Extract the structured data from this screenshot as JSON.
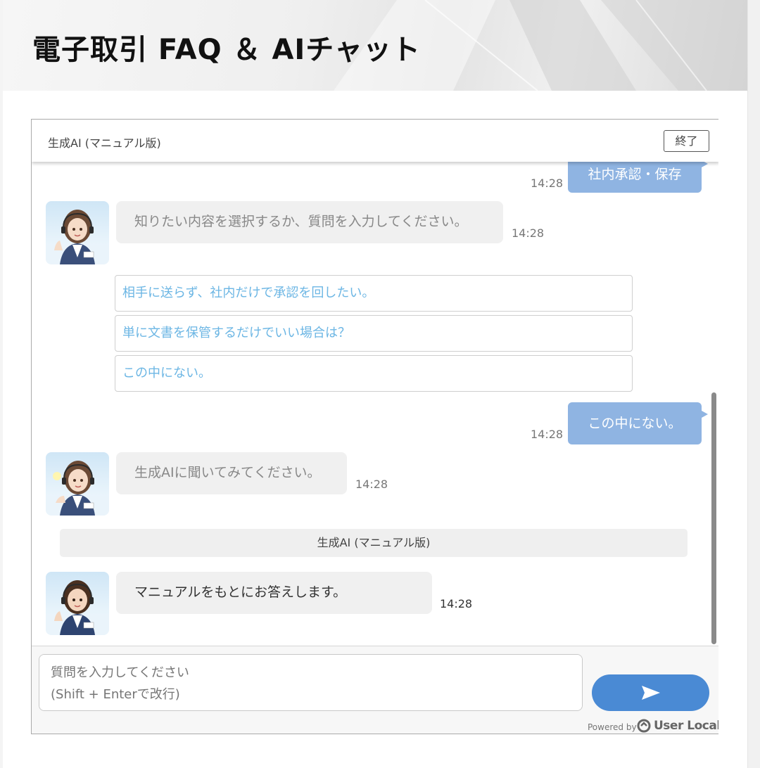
{
  "page": {
    "title": "電子取引 FAQ ＆ AIチャット"
  },
  "chat": {
    "header_title": "生成AI (マニュアル版)",
    "end_button": "終了",
    "messages": [
      {
        "role": "user",
        "text": "社内承認・保存",
        "time": "14:28"
      },
      {
        "role": "bot",
        "text": "知りたい内容を選択するか、質問を入力してください。",
        "time": "14:28"
      },
      {
        "role": "user",
        "text": "この中にない。",
        "time": "14:28"
      },
      {
        "role": "bot",
        "text": "生成AIに聞いてみてください。",
        "time": "14:28"
      },
      {
        "role": "bot",
        "text": "マニュアルをもとにお答えします。",
        "time": "14:28"
      }
    ],
    "options": [
      "相手に送らず、社内だけで承認を回したい。",
      "単に文書を保管するだけでいい場合は？",
      "この中にない。"
    ],
    "system_label": "生成AI (マニュアル版)",
    "input": {
      "placeholder": "質問を入力してください\n(Shift + Enterで改行)",
      "value": ""
    },
    "send_icon": "send-arrow-icon",
    "powered_by": "Powered by",
    "brand": "User Local"
  },
  "colors": {
    "user_bubble": "#8fb4e2",
    "bot_bubble": "#f0f0f0",
    "option_text": "#6cb6e4",
    "send_button": "#4a8ad4"
  }
}
